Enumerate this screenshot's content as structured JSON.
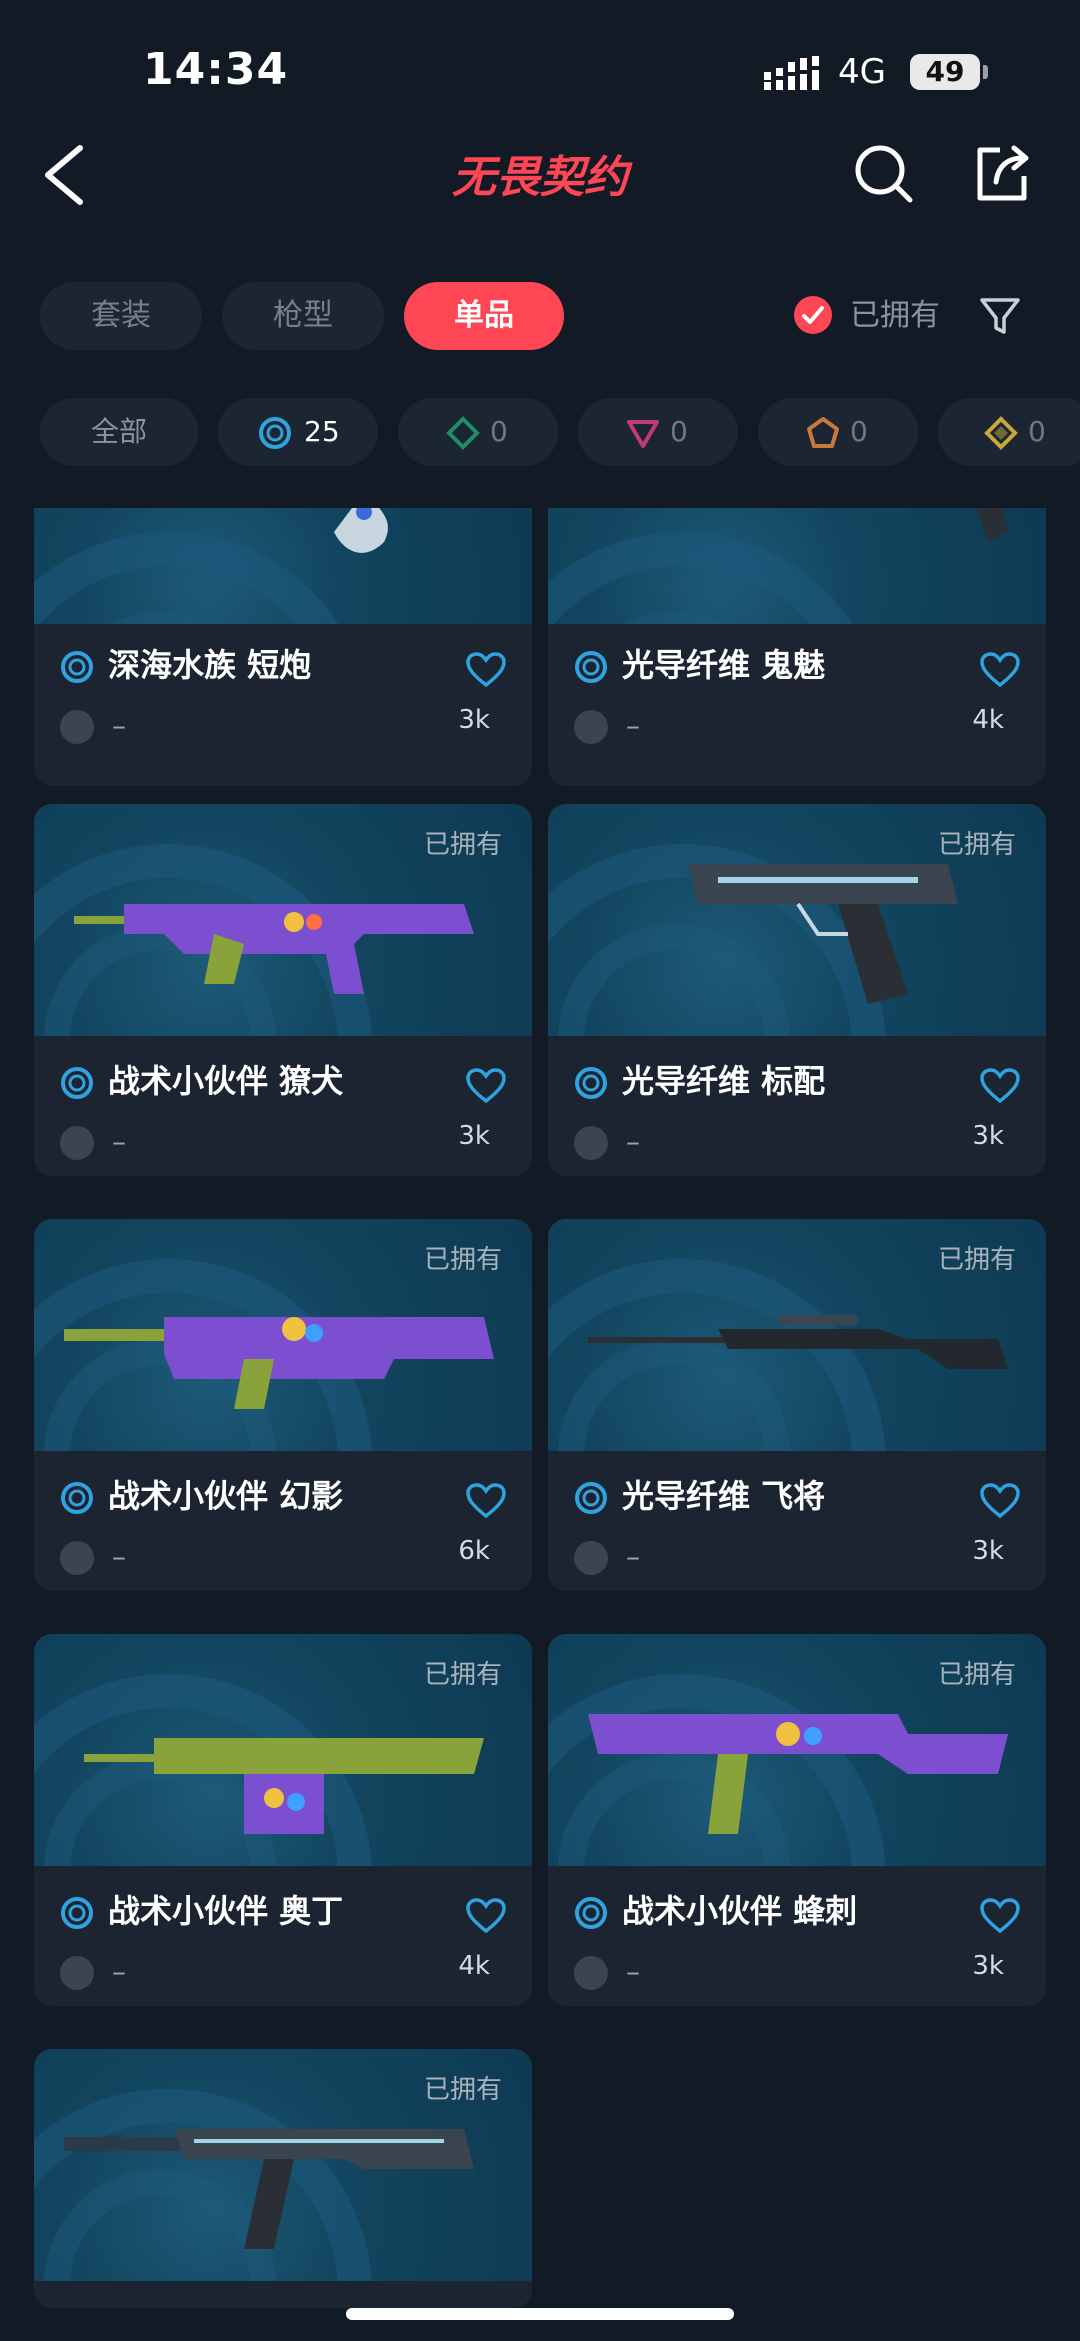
{
  "status_bar": {
    "time": "14:34",
    "network": "4G",
    "battery": "49"
  },
  "header": {
    "title": "无畏契约",
    "back_icon": "chevron-left-icon",
    "search_icon": "search-icon",
    "share_icon": "share-icon"
  },
  "tabs": [
    {
      "label": "套装"
    },
    {
      "label": "枪型"
    },
    {
      "label": "单品",
      "active": true
    }
  ],
  "owned_filter": {
    "label": "已拥有",
    "checked": true
  },
  "filter_icon": "funnel-icon",
  "chips": [
    {
      "label": "全部"
    },
    {
      "value": "25",
      "icon": "tier-blue-icon",
      "color": "#2fa3e0"
    },
    {
      "value": "0",
      "icon": "tier-green-icon",
      "color": "#1c8f6a"
    },
    {
      "value": "0",
      "icon": "tier-pink-icon",
      "color": "#c13a7a"
    },
    {
      "value": "0",
      "icon": "tier-orange-icon",
      "color": "#c97a3a"
    },
    {
      "value": "0",
      "icon": "tier-gold-icon",
      "color": "#c9a83a"
    }
  ],
  "owned_tag": "已拥有",
  "cards": [
    {
      "name": "深海水族 短炮",
      "status": "–",
      "likes": "3k",
      "owned": false
    },
    {
      "name": "光导纤维 鬼魅",
      "status": "–",
      "likes": "4k",
      "owned": false
    },
    {
      "name": "战术小伙伴 獠犬",
      "status": "–",
      "likes": "3k",
      "owned": true
    },
    {
      "name": "光导纤维 标配",
      "status": "–",
      "likes": "3k",
      "owned": true
    },
    {
      "name": "战术小伙伴 幻影",
      "status": "–",
      "likes": "6k",
      "owned": true
    },
    {
      "name": "光导纤维 飞将",
      "status": "–",
      "likes": "3k",
      "owned": true
    },
    {
      "name": "战术小伙伴 奥丁",
      "status": "–",
      "likes": "4k",
      "owned": true
    },
    {
      "name": "战术小伙伴 蜂刺",
      "status": "–",
      "likes": "3k",
      "owned": true
    },
    {
      "name": "",
      "status": "",
      "likes": "",
      "owned": true
    }
  ],
  "colors": {
    "accent": "#ff4655",
    "background": "#121a25",
    "card": "#1b2430",
    "tier_blue": "#2fa3e0",
    "heart": "#2fa3e0"
  }
}
